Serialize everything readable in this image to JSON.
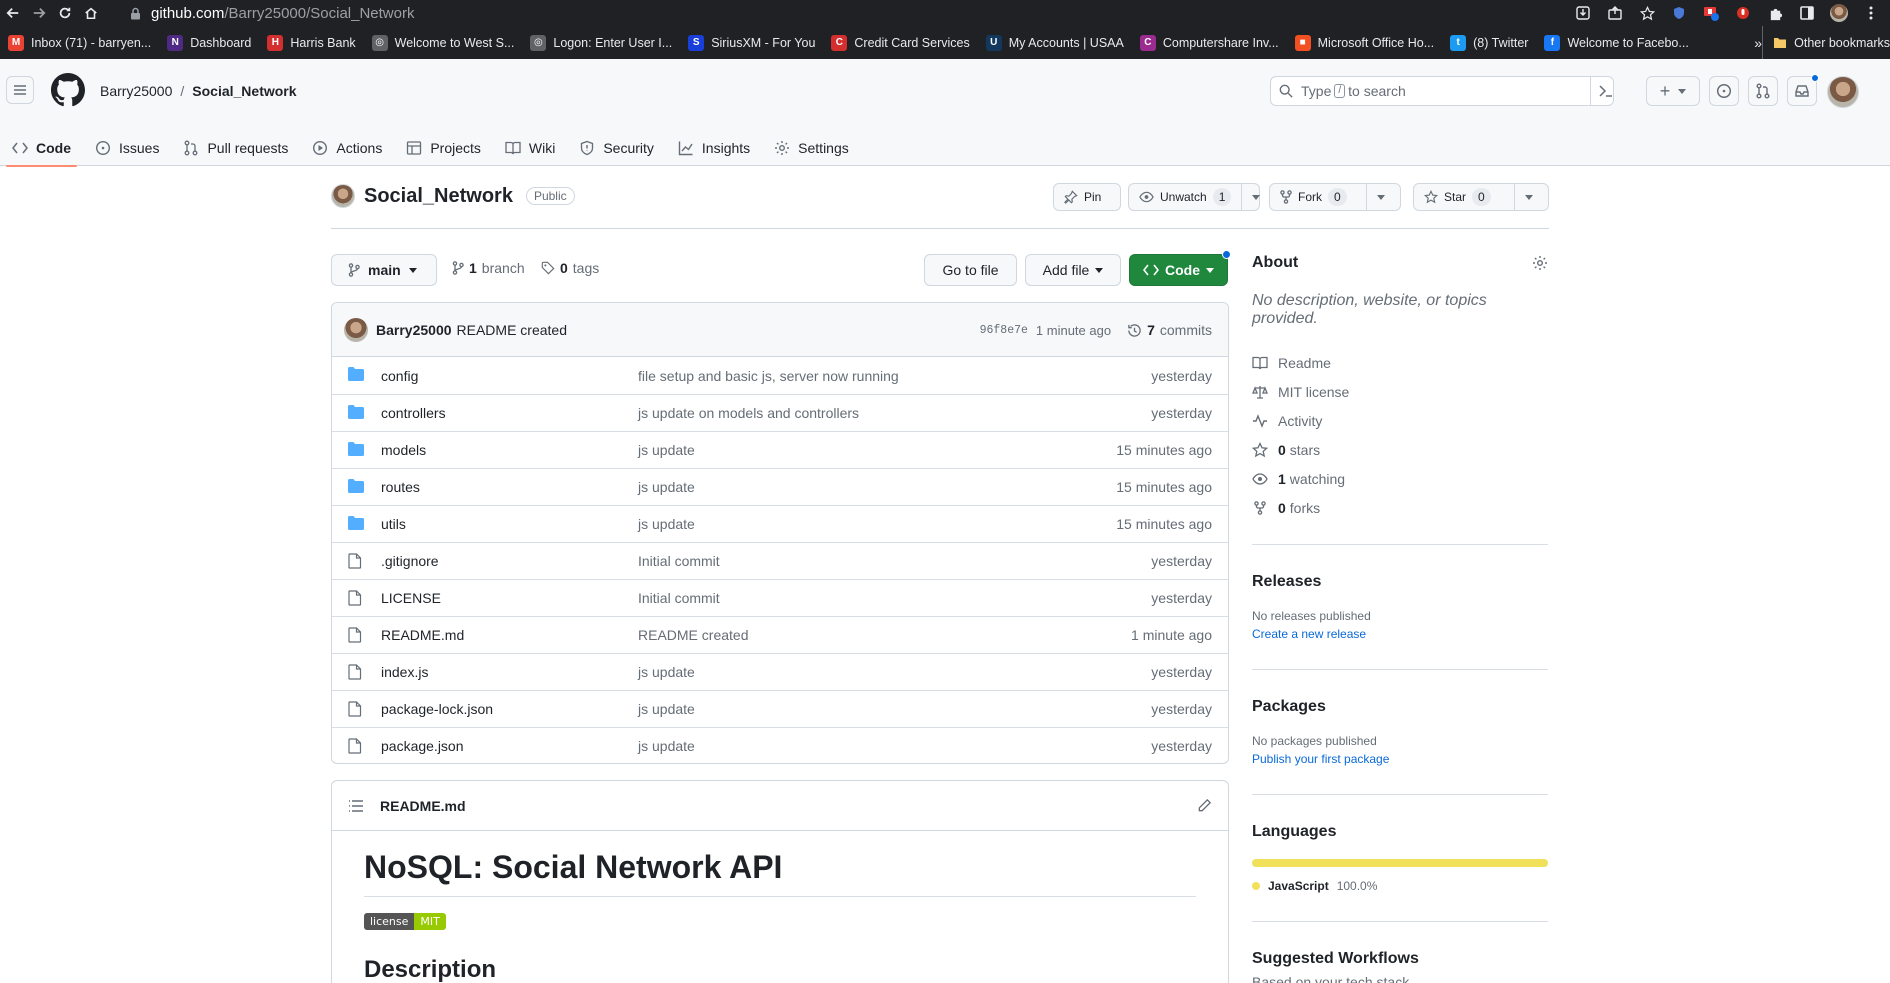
{
  "browser": {
    "url_host": "github.com",
    "url_path": "/Barry25000/Social_Network",
    "bookmarks": [
      {
        "label": "Inbox (71) - barryen...",
        "color": "#ea4335",
        "glyph": "M"
      },
      {
        "label": "Dashboard",
        "color": "#4e2a84",
        "glyph": "N"
      },
      {
        "label": "Harris Bank",
        "color": "#d32f2f",
        "glyph": "H"
      },
      {
        "label": "Welcome to West S...",
        "color": "#5f6368",
        "glyph": "◎"
      },
      {
        "label": "Logon: Enter User I...",
        "color": "#5f6368",
        "glyph": "◎"
      },
      {
        "label": "SiriusXM - For You",
        "color": "#1a3fd8",
        "glyph": "S"
      },
      {
        "label": "Credit Card Services",
        "color": "#d32f2f",
        "glyph": "C"
      },
      {
        "label": "My Accounts | USAA",
        "color": "#12385d",
        "glyph": "U"
      },
      {
        "label": "Computershare Inv...",
        "color": "#9b2c8f",
        "glyph": "C"
      },
      {
        "label": "Microsoft Office Ho...",
        "color": "#f25022",
        "glyph": "■"
      },
      {
        "label": "(8) Twitter",
        "color": "#1d9bf0",
        "glyph": "t"
      },
      {
        "label": "Welcome to Facebo...",
        "color": "#1877f2",
        "glyph": "f"
      }
    ],
    "bookmarks_more": "»",
    "other_bookmarks": "Other bookmarks"
  },
  "header": {
    "owner": "Barry25000",
    "separator": "/",
    "repo": "Social_Network",
    "search_prefix": "Type",
    "search_key": "/",
    "search_suffix": "to search",
    "new_label": "+"
  },
  "repo_nav": [
    {
      "label": "Code",
      "icon": "code-icon",
      "active": true
    },
    {
      "label": "Issues",
      "icon": "issue-icon"
    },
    {
      "label": "Pull requests",
      "icon": "pull-request-icon"
    },
    {
      "label": "Actions",
      "icon": "play-icon"
    },
    {
      "label": "Projects",
      "icon": "table-icon"
    },
    {
      "label": "Wiki",
      "icon": "book-icon"
    },
    {
      "label": "Security",
      "icon": "shield-icon"
    },
    {
      "label": "Insights",
      "icon": "graph-icon"
    },
    {
      "label": "Settings",
      "icon": "gear-icon"
    }
  ],
  "repo": {
    "name": "Social_Network",
    "visibility": "Public",
    "pin_label": "Pin",
    "unwatch_label": "Unwatch",
    "watch_count": "1",
    "fork_label": "Fork",
    "fork_count": "0",
    "star_label": "Star",
    "star_count": "0"
  },
  "toolbar": {
    "branch": "main",
    "branch_count": "1",
    "branch_word": "branch",
    "tag_count": "0",
    "tag_word": "tags",
    "go_to_file": "Go to file",
    "add_file": "Add file",
    "code": "Code"
  },
  "latest_commit": {
    "author": "Barry25000",
    "message": "README created",
    "sha": "96f8e7e",
    "age": "1 minute ago",
    "commit_count": "7",
    "commit_word": "commits"
  },
  "files": [
    {
      "name": "config",
      "type": "dir",
      "message": "file setup and basic js, server now running",
      "age": "yesterday"
    },
    {
      "name": "controllers",
      "type": "dir",
      "message": "js update on models and controllers",
      "age": "yesterday"
    },
    {
      "name": "models",
      "type": "dir",
      "message": "js update",
      "age": "15 minutes ago"
    },
    {
      "name": "routes",
      "type": "dir",
      "message": "js update",
      "age": "15 minutes ago"
    },
    {
      "name": "utils",
      "type": "dir",
      "message": "js update",
      "age": "15 minutes ago"
    },
    {
      "name": ".gitignore",
      "type": "file",
      "message": "Initial commit",
      "age": "yesterday"
    },
    {
      "name": "LICENSE",
      "type": "file",
      "message": "Initial commit",
      "age": "yesterday"
    },
    {
      "name": "README.md",
      "type": "file",
      "message": "README created",
      "age": "1 minute ago"
    },
    {
      "name": "index.js",
      "type": "file",
      "message": "js update",
      "age": "yesterday"
    },
    {
      "name": "package-lock.json",
      "type": "file",
      "message": "js update",
      "age": "yesterday"
    },
    {
      "name": "package.json",
      "type": "file",
      "message": "js update",
      "age": "yesterday"
    }
  ],
  "readme": {
    "filename": "README.md",
    "title": "NoSQL: Social Network API",
    "badge_left": "license",
    "badge_right": "MIT",
    "section": "Description"
  },
  "sidebar": {
    "about_title": "About",
    "about_desc": "No description, website, or topics provided.",
    "readme": "Readme",
    "license": "MIT license",
    "activity": "Activity",
    "stars_count": "0",
    "stars_word": "stars",
    "watching_count": "1",
    "watching_word": "watching",
    "forks_count": "0",
    "forks_word": "forks",
    "releases_title": "Releases",
    "releases_none": "No releases published",
    "releases_link": "Create a new release",
    "packages_title": "Packages",
    "packages_none": "No packages published",
    "packages_link": "Publish your first package",
    "languages_title": "Languages",
    "language_name": "JavaScript",
    "language_pct": "100.0%",
    "language_color": "#f1e05a",
    "workflows_title": "Suggested Workflows",
    "workflows_sub": "Based on your tech stack"
  },
  "colors": {
    "accent": "#0969da",
    "primary_button": "#1f883d",
    "folder": "#54aeff",
    "active_tab_underline": "#fd8c73"
  }
}
